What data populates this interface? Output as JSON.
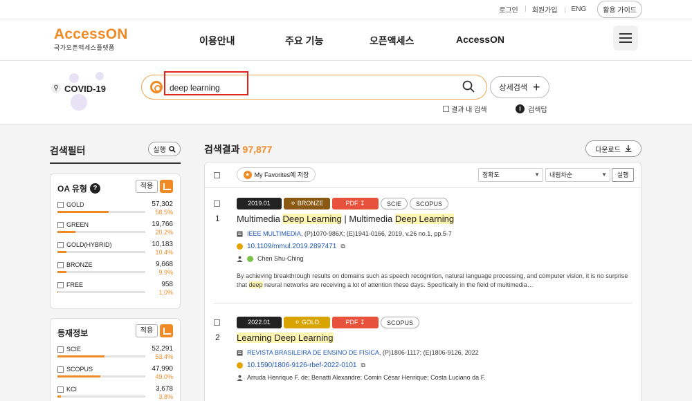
{
  "topbar": {
    "links": [
      "로그인",
      "회원가입",
      "ENG"
    ],
    "guide": "활용 가이드"
  },
  "header": {
    "logo_text": "AccessON",
    "logo_sub": "국가오픈액세스플랫폼",
    "nav": [
      "이용안내",
      "주요 기능",
      "오픈액세스",
      "AccessON"
    ]
  },
  "search": {
    "covid_label": "COVID-19",
    "query": "deep learning",
    "detail_label": "상세검색",
    "in_results_label": "결과 내 검색",
    "tip_label": "검색팁"
  },
  "sidebar": {
    "title": "검색필터",
    "run_label": "실행",
    "apply_label": "적용",
    "oa_panel": {
      "title": "OA 유형",
      "items": [
        {
          "name": "GOLD",
          "count": "57,302",
          "pct": "58.5%",
          "fill": 0.585
        },
        {
          "name": "GREEN",
          "count": "19,766",
          "pct": "20.2%",
          "fill": 0.202
        },
        {
          "name": "GOLD(HYBRID)",
          "count": "10,183",
          "pct": "10.4%",
          "fill": 0.104
        },
        {
          "name": "BRONZE",
          "count": "9,668",
          "pct": "9.9%",
          "fill": 0.099
        },
        {
          "name": "FREE",
          "count": "958",
          "pct": "1.0%",
          "fill": 0.01
        }
      ]
    },
    "index_panel": {
      "title": "등재정보",
      "items": [
        {
          "name": "SCIE",
          "count": "52,291",
          "pct": "53.4%",
          "fill": 0.534
        },
        {
          "name": "SCOPUS",
          "count": "47,990",
          "pct": "49.0%",
          "fill": 0.49
        },
        {
          "name": "KCI",
          "count": "3,678",
          "pct": "3.8%",
          "fill": 0.038
        }
      ]
    }
  },
  "results": {
    "label": "검색결과",
    "count": "97,877",
    "download_label": "다운로드",
    "favorites_label": "My Favorites에 저장",
    "sort_options": [
      "정확도",
      "내림차순"
    ],
    "sort_run": "실행",
    "items": [
      {
        "num": "1",
        "date": "2019.01",
        "oa": "BRONZE",
        "pdf": "PDF",
        "indexes": [
          "SCIE",
          "SCOPUS"
        ],
        "title_parts": [
          {
            "t": "Multimedia ",
            "h": false
          },
          {
            "t": "Deep Learning",
            "h": true
          },
          {
            "t": " | Multimedia ",
            "h": false
          },
          {
            "t": "Deep Learning",
            "h": true
          }
        ],
        "journal": "IEEE MULTIMEDIA",
        "journal_rest": ", (P)1070-986X; (E)1941-0166, 2019, v.26 no.1, pp.5-7",
        "doi": "10.1109/mmul.2019.2897471",
        "authors": "Chen Shu-Ching",
        "abstract_parts": [
          {
            "t": "By achieving breakthrough results on domains such as speech recognition, natural language processing, and computer vision, it is no surprise that ",
            "h": false
          },
          {
            "t": "deep",
            "h": true
          },
          {
            "t": " neural networks are receiving a lot of attention these days. Specifically in the field of multimedia…",
            "h": false
          }
        ]
      },
      {
        "num": "2",
        "date": "2022.01",
        "oa": "GOLD",
        "pdf": "PDF",
        "indexes": [
          "SCOPUS"
        ],
        "title_parts": [
          {
            "t": "Learning Deep Learning",
            "h": true
          }
        ],
        "journal": "REVISTA BRASILEIRA DE ENSINO DE FISICA",
        "journal_rest": ", (P)1806-1117; (E)1806-9126, 2022",
        "doi": "10.1590/1806-9126-rbef-2022-0101",
        "authors": "Arruda Henrique F. de;  Benatti Alexandre;  Comin César Henrique;  Costa Luciano da F."
      }
    ]
  },
  "colors": {
    "accent": "#f08a24",
    "highlight_box": "#e2231a",
    "bronze": "#8a5a14",
    "gold": "#d9a400",
    "pdf": "#e8513c"
  }
}
